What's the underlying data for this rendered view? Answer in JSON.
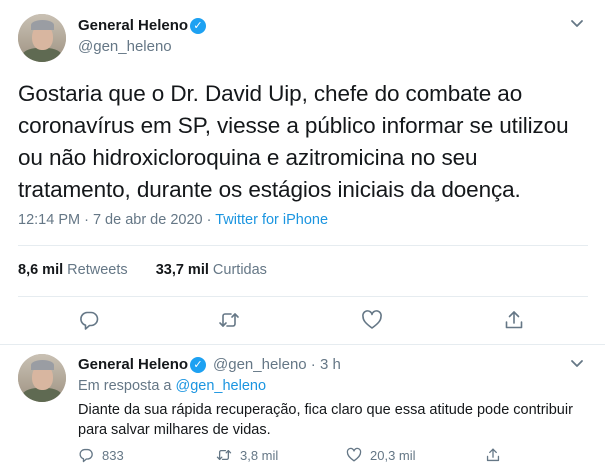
{
  "main_tweet": {
    "author_name": "General Heleno",
    "author_handle": "@gen_heleno",
    "text": "Gostaria que o Dr. David Uip, chefe do combate ao coronavírus em SP, viesse a público informar se utilizou ou não hidroxicloroquina e azitromicina no seu tratamento, durante os estágios iniciais da doença.",
    "timestamp": "12:14 PM · 7 de abr de 2020 · ",
    "source": "Twitter for iPhone",
    "retweets_count": "8,6 mil",
    "retweets_label": "Retweets",
    "likes_count": "33,7 mil",
    "likes_label": "Curtidas"
  },
  "reply_tweet": {
    "author_name": "General Heleno",
    "author_handle_time": "@gen_heleno · 3 h",
    "in_reply_prefix": "Em resposta a ",
    "in_reply_mention": "@gen_heleno",
    "text": "Diante da sua rápida recuperação, fica claro que essa atitude pode contribuir para salvar milhares de vidas.",
    "reply_count": "833",
    "retweet_count": "3,8 mil",
    "like_count": "20,3 mil"
  },
  "icons": {
    "verified": "verified-badge-icon",
    "chevron": "chevron-down-icon",
    "reply": "reply-icon",
    "retweet": "retweet-icon",
    "like": "heart-icon",
    "share": "share-icon"
  },
  "colors": {
    "accent": "#1da1f2",
    "link": "#1b95e0",
    "secondary_text": "#657786",
    "primary_text": "#14171a",
    "border": "#e6ecf0"
  }
}
